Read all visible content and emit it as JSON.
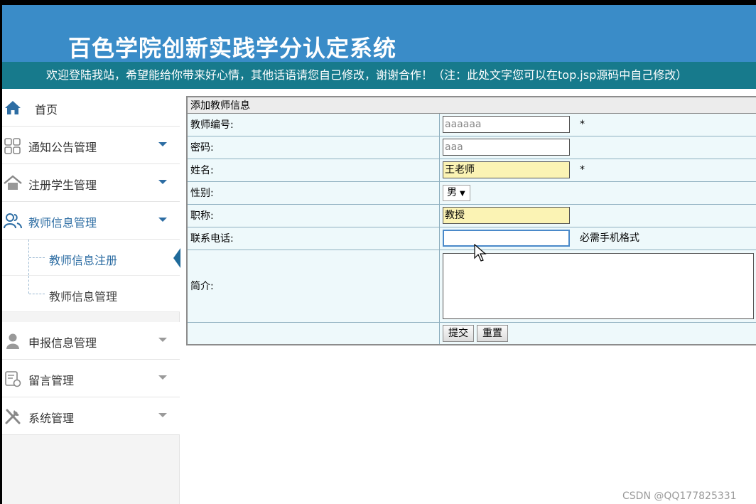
{
  "header": {
    "title": "百色学院创新实践学分认定系统",
    "welcome": "欢迎登陆我站，希望能给你带来好心情，其他话语请您自己修改，谢谢合作！（注：此处文字您可以在top.jsp源码中自己修改）"
  },
  "sidebar": {
    "home": "首页",
    "notice": "通知公告管理",
    "students": "注册学生管理",
    "teachers": "教师信息管理",
    "teacher_register": "教师信息注册",
    "teacher_manage": "教师信息管理",
    "declare": "申报信息管理",
    "messages": "留言管理",
    "system": "系统管理"
  },
  "form": {
    "caption": "添加教师信息",
    "fields": {
      "teacher_id": {
        "label": "教师编号:",
        "value": "aaaaaa",
        "required": "*"
      },
      "password": {
        "label": "密码:",
        "value": "aaa"
      },
      "name": {
        "label": "姓名:",
        "value": "王老师",
        "required": "*"
      },
      "gender": {
        "label": "性别:",
        "value": "男"
      },
      "title": {
        "label": "职称:",
        "value": "教授"
      },
      "phone": {
        "label": "联系电话:",
        "value": "",
        "hint": "必需手机格式"
      },
      "intro": {
        "label": "简介:",
        "value": ""
      }
    },
    "submit": "提交",
    "reset": "重置"
  },
  "watermark": "CSDN @QQ177825331",
  "colors": {
    "header": "#3a8cc8",
    "welcome_bar": "#177a8c",
    "accent": "#2d6da3",
    "input_highlight": "#fbf3b4",
    "row_bg": "#eef9fb"
  }
}
